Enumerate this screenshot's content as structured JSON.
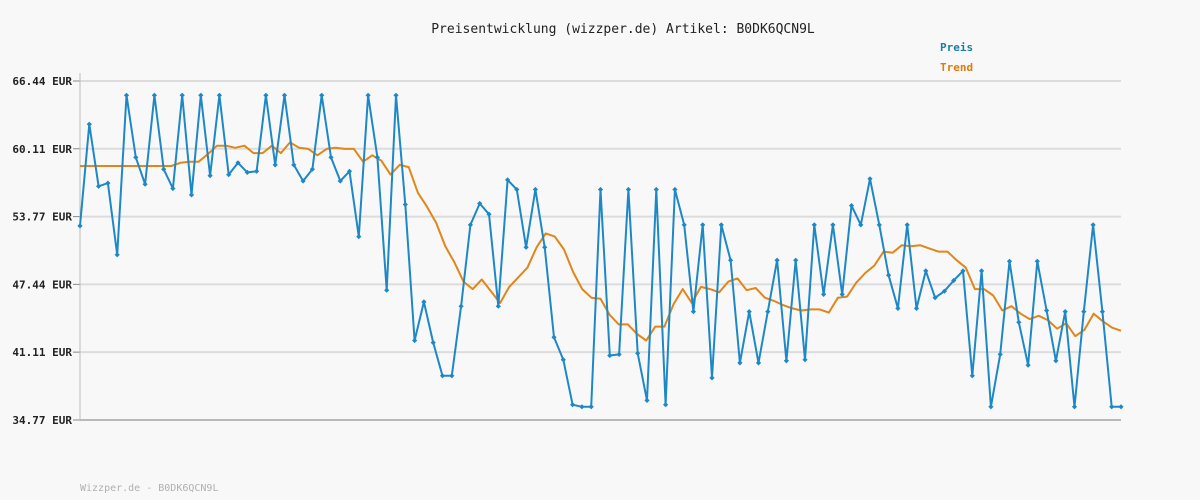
{
  "chart_data": {
    "type": "line",
    "title": "Preisentwicklung (wizzper.de) Artikel: B0DK6QCN9L",
    "ylim": [
      34.77,
      66.44
    ],
    "yticks": [
      "66.44 EUR",
      "60.11 EUR",
      "53.77 EUR",
      "47.44 EUR",
      "41.11 EUR",
      "34.77 EUR"
    ],
    "ytick_values": [
      66.44,
      60.11,
      53.77,
      47.44,
      41.11,
      34.77
    ],
    "grid": true,
    "legend_position": "top-right",
    "series": [
      {
        "name": "Preis",
        "color": "#1e88c7",
        "values": [
          52.9,
          62.4,
          56.6,
          56.9,
          50.2,
          65.1,
          59.3,
          56.8,
          65.1,
          58.2,
          56.4,
          65.1,
          55.8,
          65.1,
          57.6,
          65.1,
          57.7,
          58.8,
          57.9,
          58.0,
          65.1,
          58.6,
          65.1,
          58.6,
          57.1,
          58.2,
          65.1,
          59.3,
          57.1,
          58.0,
          51.9,
          65.1,
          59.3,
          46.9,
          65.1,
          54.9,
          42.2,
          45.8,
          42.0,
          38.9,
          38.9,
          45.4,
          53.0,
          55.0,
          54.0,
          45.4,
          57.2,
          56.3,
          50.9,
          56.3,
          50.9,
          42.5,
          40.4,
          36.2,
          36.0,
          36.0,
          56.3,
          40.8,
          40.9,
          56.3,
          41.0,
          36.6,
          56.3,
          36.2,
          56.3,
          53.0,
          44.9,
          53.0,
          38.7,
          53.0,
          49.7,
          40.1,
          44.9,
          40.1,
          44.9,
          49.7,
          40.3,
          49.7,
          40.4,
          53.0,
          46.5,
          53.0,
          46.5,
          54.8,
          53.0,
          57.3,
          53.0,
          48.3,
          45.2,
          53.0,
          45.2,
          48.7,
          46.2,
          46.8,
          47.8,
          48.7,
          38.9,
          48.7,
          36.0,
          40.9,
          49.6,
          43.9,
          39.9,
          49.6,
          45.0,
          40.3,
          44.9,
          36.0,
          44.9,
          53.0,
          44.9,
          36.0,
          36.0
        ]
      },
      {
        "name": "Trend",
        "color": "#e0861a",
        "values": [
          58.5,
          58.5,
          58.5,
          58.5,
          58.5,
          58.5,
          58.5,
          58.5,
          58.5,
          58.5,
          58.5,
          58.8,
          58.9,
          58.9,
          59.6,
          60.4,
          60.4,
          60.2,
          60.4,
          59.7,
          59.7,
          60.4,
          59.7,
          60.7,
          60.2,
          60.1,
          59.5,
          60.1,
          60.2,
          60.1,
          60.1,
          58.9,
          59.5,
          59.0,
          57.7,
          58.6,
          58.4,
          56.0,
          54.7,
          53.2,
          51.0,
          49.5,
          47.7,
          47.0,
          47.9,
          46.8,
          45.7,
          47.2,
          48.1,
          49.0,
          50.9,
          52.2,
          51.9,
          50.7,
          48.6,
          47.0,
          46.2,
          46.1,
          44.6,
          43.7,
          43.7,
          42.8,
          42.2,
          43.5,
          43.5,
          45.6,
          47.0,
          45.7,
          47.2,
          47.0,
          46.7,
          47.7,
          48.0,
          46.9,
          47.1,
          46.2,
          45.9,
          45.5,
          45.2,
          45.0,
          45.1,
          45.1,
          44.8,
          46.2,
          46.3,
          47.6,
          48.5,
          49.2,
          50.5,
          50.4,
          51.1,
          51.0,
          51.1,
          50.8,
          50.5,
          50.5,
          49.7,
          49.0,
          47.0,
          47.0,
          46.4,
          45.0,
          45.4,
          44.7,
          44.2,
          44.5,
          44.1,
          43.3,
          43.8,
          42.6,
          43.2,
          44.7,
          44.0,
          43.4,
          43.1
        ]
      }
    ]
  },
  "footer": "Wizzper.de - B0DK6QCN9L"
}
